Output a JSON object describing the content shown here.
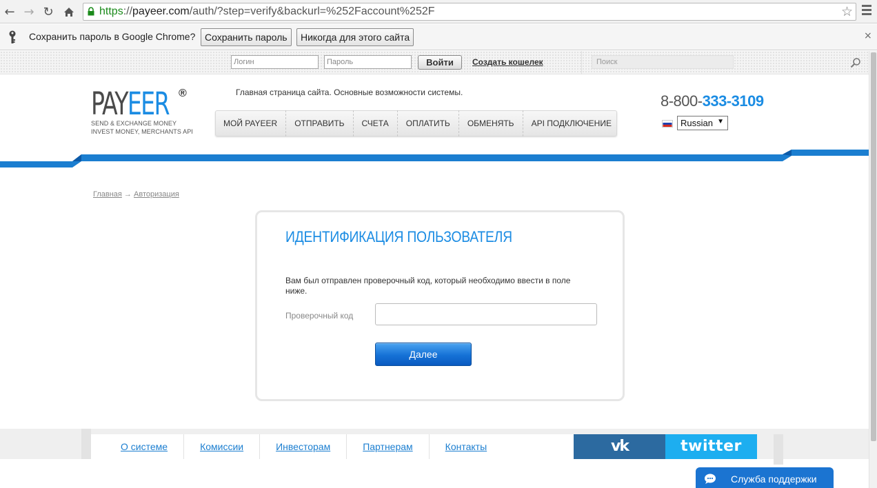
{
  "browser": {
    "url_scheme": "https",
    "url_host": "payeer.com",
    "url_path": "/auth/?step=verify&backurl=%252Faccount%252F",
    "url_sep": "://"
  },
  "password_bar": {
    "prompt": "Сохранить пароль в Google Chrome?",
    "save_label": "Сохранить пароль",
    "never_label": "Никогда для этого сайта",
    "close": "×"
  },
  "top_bar": {
    "login_placeholder": "Логин",
    "password_placeholder": "Пароль",
    "login_button": "Войти",
    "create_wallet": "Создать кошелек",
    "search_placeholder": "Поиск"
  },
  "header": {
    "logo_pay": "PAY",
    "logo_eer": "EER",
    "logo_reg": "®",
    "logo_tag1": "SEND & EXCHANGE MONEY",
    "logo_tag2": "INVEST MONEY, MERCHANTS API",
    "tagline": "Главная страница сайта. Основные возможности системы.",
    "nav": [
      "МОЙ PAYEER",
      "ОТПРАВИТЬ",
      "СЧЕТА",
      "ОПЛАТИТЬ",
      "ОБМЕНЯТЬ",
      "API ПОДКЛЮЧЕНИЕ"
    ],
    "phone_prefix": "8-800-",
    "phone_number": "333-3109",
    "language": "Russian",
    "lang_arrow": "▼"
  },
  "breadcrumb": {
    "home": "Главная",
    "arrow": " → ",
    "current": "Авторизация"
  },
  "auth": {
    "title": "ИДЕНТИФИКАЦИЯ ПОЛЬЗОВАТЕЛЯ",
    "message": "Вам был отправлен проверочный код, который необходимо ввести в поле ниже.",
    "code_label": "Проверочный код",
    "code_value": "",
    "next_button": "Далее"
  },
  "footer": {
    "links": [
      "О системе",
      "Комиссии",
      "Инвесторам",
      "Партнерам",
      "Контакты"
    ],
    "vk": "vk",
    "twitter": "twitter"
  },
  "support": {
    "label": "Служба поддержки"
  },
  "colors": {
    "brand_blue": "#1b8ce3",
    "stripe_blue": "#1b7ed0",
    "vk": "#2c6aa0",
    "twitter": "#1daef0"
  }
}
